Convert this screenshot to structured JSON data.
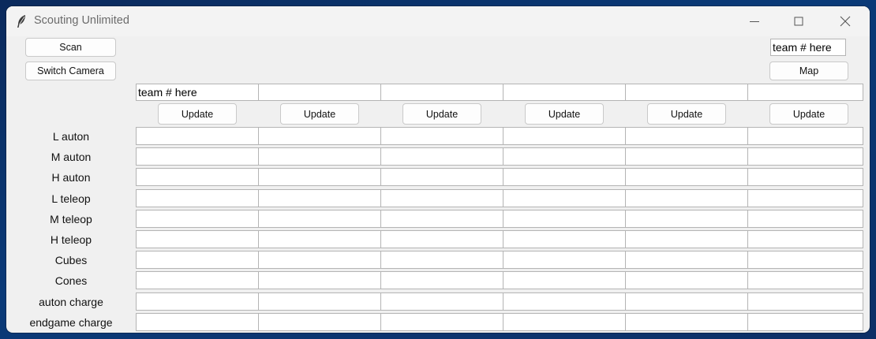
{
  "window": {
    "title": "Scouting Unlimited"
  },
  "toolbar": {
    "scan_label": "Scan",
    "switch_camera_label": "Switch Camera",
    "map_label": "Map",
    "map_team_value": "team # here"
  },
  "columns": [
    {
      "team_value": "team # here",
      "update_label": "Update"
    },
    {
      "team_value": "",
      "update_label": "Update"
    },
    {
      "team_value": "",
      "update_label": "Update"
    },
    {
      "team_value": "",
      "update_label": "Update"
    },
    {
      "team_value": "",
      "update_label": "Update"
    },
    {
      "team_value": "",
      "update_label": "Update"
    }
  ],
  "rows": [
    "L auton",
    "M auton",
    "H auton",
    "L teleop",
    "M teleop",
    "H teleop",
    "Cubes",
    "Cones",
    "auton charge",
    "endgame charge"
  ],
  "icons": {
    "app": "feather-icon",
    "minimize": "minimize-icon",
    "maximize": "maximize-icon",
    "close": "close-icon"
  }
}
